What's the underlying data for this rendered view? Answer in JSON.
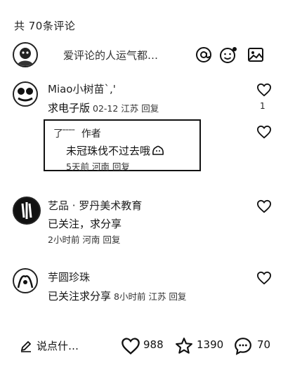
{
  "header": {
    "comment_count_label": "共 70条评论"
  },
  "compose": {
    "placeholder": "爱评论的人运气都…"
  },
  "comments": [
    {
      "name": "Miao小树苗`,'",
      "body": "求电子版",
      "meta": "02-12 江苏 回复",
      "like_count": "1"
    },
    {
      "name": "艺品 · 罗丹美术教育",
      "body": "已关注，求分享",
      "meta": "2小时前 河南 回复",
      "like_count": ""
    },
    {
      "name": "芋圆珍珠",
      "body": "已关注求分享",
      "meta": "8小时前 江苏 回复",
      "like_count": ""
    }
  ],
  "reply": {
    "name": "了 ̄ ̄ ̄ ̄",
    "author_badge": "作者",
    "body": "未冠珠伐不过去哦",
    "meta": "5天前 河南 回复"
  },
  "bottom_bar": {
    "input_label": "说点什…",
    "likes": "988",
    "favorites": "1390",
    "comments": "70"
  }
}
